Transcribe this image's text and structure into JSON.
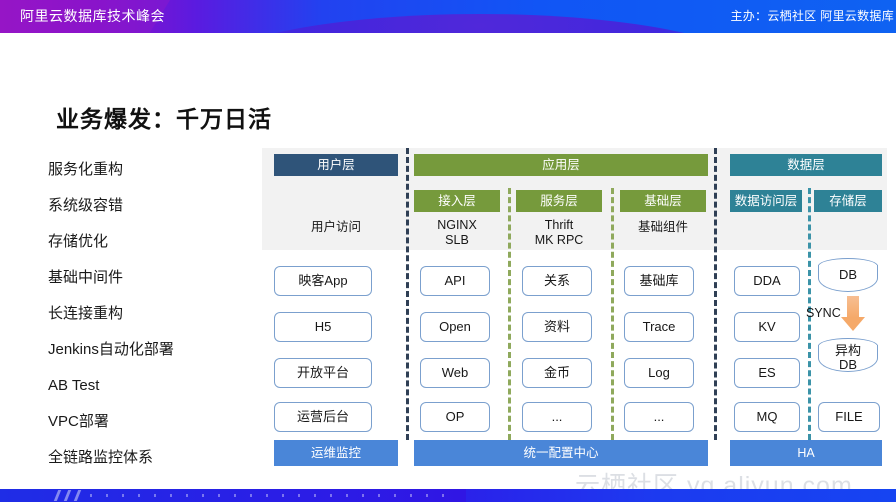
{
  "topbar": {
    "title": "阿里云数据库技术峰会",
    "organizer": "主办：云栖社区 阿里云数据库"
  },
  "slide": {
    "title": "业务爆发：千万日活"
  },
  "left_list": {
    "items": [
      "服务化重构",
      "系统级容错",
      "存储优化",
      "基础中间件",
      "长连接重构",
      "Jenkins自动化部署",
      "AB Test",
      "VPC部署",
      "全链路监控体系"
    ]
  },
  "diagram": {
    "layers": [
      {
        "key": "user",
        "label": "用户层",
        "color": "#2F5479"
      },
      {
        "key": "app",
        "label": "应用层",
        "color": "#769A3C"
      },
      {
        "key": "data",
        "label": "数据层",
        "color": "#2E8296"
      }
    ],
    "sublayers": [
      {
        "key": "access",
        "label": "接入层",
        "color": "#769A3C"
      },
      {
        "key": "service",
        "label": "服务层",
        "color": "#769A3C"
      },
      {
        "key": "base",
        "label": "基础层",
        "color": "#769A3C"
      },
      {
        "key": "dao",
        "label": "数据访问层",
        "color": "#2E8296"
      },
      {
        "key": "storage",
        "label": "存储层",
        "color": "#2E8296"
      }
    ],
    "captions": {
      "user": "用户访问",
      "access_line1": "NGINX",
      "access_line2": "SLB",
      "service_line1": "Thrift",
      "service_line2": "MK RPC",
      "base": "基础组件"
    },
    "columns": {
      "user": [
        "映客App",
        "H5",
        "开放平台",
        "运营后台"
      ],
      "access": [
        "API",
        "Open",
        "Web",
        "OP"
      ],
      "service": [
        "关系",
        "资料",
        "金币",
        "..."
      ],
      "base": [
        "基础库",
        "Trace",
        "Log",
        "..."
      ],
      "dao": [
        "DDA",
        "KV",
        "ES",
        "MQ"
      ]
    },
    "storage": {
      "db": "DB",
      "sync": "SYNC",
      "heterogeneous_line1": "异构",
      "heterogeneous_line2": "DB",
      "file": "FILE"
    },
    "bottom_bars": [
      {
        "key": "ops",
        "label": "运维监控",
        "color": "#4A86D8"
      },
      {
        "key": "config",
        "label": "统一配置中心",
        "color": "#4A86D8"
      },
      {
        "key": "ha",
        "label": "HA",
        "color": "#4A86D8"
      }
    ]
  },
  "watermark": "云栖社区 yq.aliyun.com"
}
